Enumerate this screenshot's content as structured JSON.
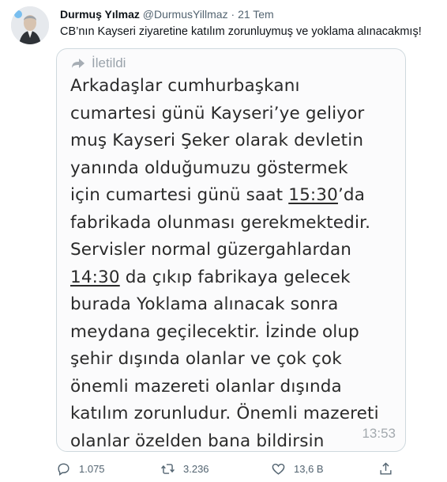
{
  "tweet": {
    "author_name": "Durmuş Yılmaz",
    "author_handle": "@DurmusYillmaz",
    "separator": "·",
    "date": "21 Tem",
    "text": "CB’nın Kayseri ziyaretine katılım zorunluymuş ve yoklama alınacakmış!"
  },
  "image": {
    "forwarded_label": "İletildi",
    "lines": [
      [
        "Arkadaşlar cumhurbaşkanı"
      ],
      [
        "cumartesi günü Kayseri’ye geliyor"
      ],
      [
        "muş Kayseri Şeker olarak devletin"
      ],
      [
        "yanında olduğumuzu göstermek"
      ],
      [
        "için cumartesi günü saat ",
        "15:30",
        "’da"
      ],
      [
        "fabrikada olunması gerekmektedir."
      ],
      [
        "Servisler normal güzergahlardan"
      ],
      [
        "",
        "14:30",
        " da çıkıp fabrikaya gelecek"
      ],
      [
        "burada Yoklama alınacak sonra"
      ],
      [
        "meydana geçilecektir. İzinde olup"
      ],
      [
        "şehir dışında olanlar ve çok çok"
      ],
      [
        "önemli mazereti olanlar dışında"
      ],
      [
        "katılım zorunludur. Önemli mazereti"
      ],
      [
        "olanlar özelden bana bildirsin"
      ]
    ],
    "time": "13:53"
  },
  "actions": {
    "reply_count": "1.075",
    "retweet_count": "3.236",
    "like_count": "13,6 B"
  },
  "icons": [
    "avatar",
    "forward-icon",
    "reply-icon",
    "retweet-icon",
    "like-icon",
    "share-icon"
  ],
  "colors": {
    "text": "#0f1419",
    "muted": "#536471",
    "border": "#cfd9de"
  }
}
